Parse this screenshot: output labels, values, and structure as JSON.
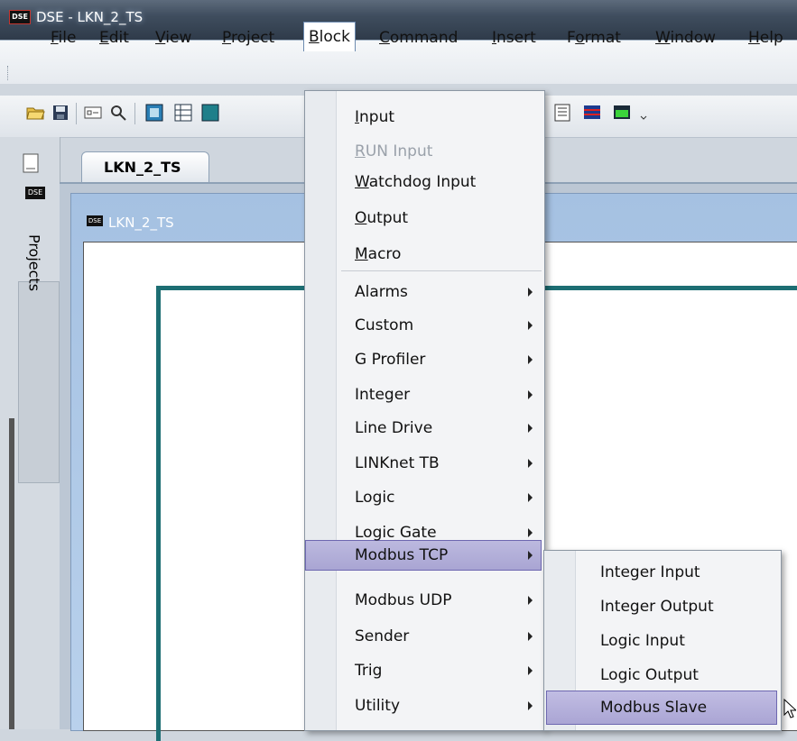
{
  "window": {
    "title": "DSE - LKN_2_TS",
    "logo_text": "DSE"
  },
  "menubar": {
    "items": [
      {
        "pre": "",
        "u": "F",
        "post": "ile"
      },
      {
        "pre": "",
        "u": "E",
        "post": "dit"
      },
      {
        "pre": "",
        "u": "V",
        "post": "iew"
      },
      {
        "pre": "",
        "u": "P",
        "post": "roject"
      },
      {
        "pre": "",
        "u": "B",
        "post": "lock"
      },
      {
        "pre": "",
        "u": "C",
        "post": "ommand"
      },
      {
        "pre": "",
        "u": "I",
        "post": "nsert"
      },
      {
        "pre": "F",
        "u": "o",
        "post": "rmat"
      },
      {
        "pre": "",
        "u": "W",
        "post": "indow"
      },
      {
        "pre": "",
        "u": "H",
        "post": "elp"
      }
    ]
  },
  "sidebar": {
    "label": "Projects"
  },
  "document": {
    "tab": "LKN_2_TS",
    "child_title": "LKN_2_TS",
    "child_logo": "DSE"
  },
  "block_menu": {
    "top_items": [
      {
        "pre": "",
        "u": "I",
        "post": "nput",
        "disabled": false
      },
      {
        "pre": "",
        "u": "R",
        "post": "UN Input",
        "disabled": true
      },
      {
        "pre": "",
        "u": "W",
        "post": "atchdog Input",
        "disabled": false
      },
      {
        "pre": "",
        "u": "O",
        "post": "utput",
        "disabled": false
      },
      {
        "pre": "",
        "u": "M",
        "post": "acro",
        "disabled": false
      }
    ],
    "submenu_items": [
      "Alarms",
      "Custom",
      "G Profiler",
      "Integer",
      "Line Drive",
      "LINKnet TB",
      "Logic",
      "Logic Gate",
      "Modbus TCP",
      "Modbus UDP",
      "Sender",
      "Trig",
      "Utility"
    ],
    "highlighted": "Modbus TCP"
  },
  "modbus_tcp_submenu": {
    "items": [
      "Integer Input",
      "Integer Output",
      "Logic Input",
      "Logic Output",
      "Modbus Slave"
    ],
    "highlighted": "Modbus Slave"
  }
}
